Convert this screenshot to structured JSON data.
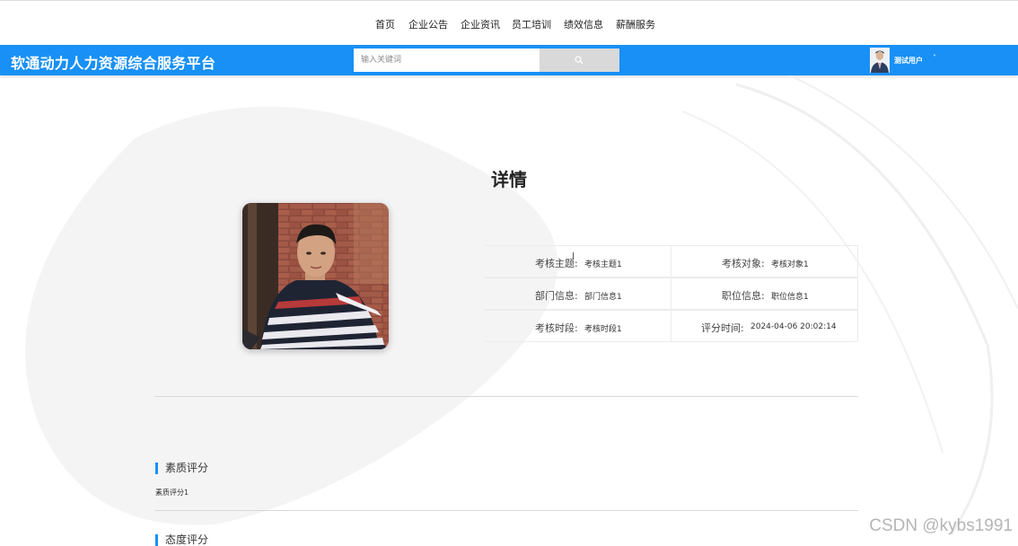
{
  "topnav": {
    "items": [
      {
        "label": "首页"
      },
      {
        "label": "企业公告"
      },
      {
        "label": "企业资讯"
      },
      {
        "label": "员工培训"
      },
      {
        "label": "绩效信息"
      },
      {
        "label": "薪酬服务"
      }
    ]
  },
  "header": {
    "brand": "软通动力人力资源综合服务平台",
    "search": {
      "placeholder": "输入关键词",
      "icon": "search-icon"
    },
    "user": {
      "name": "测试用户",
      "caret": "˅"
    },
    "color": "#1890f5"
  },
  "main": {
    "title": "详情",
    "details": [
      {
        "label": "考核主题:",
        "value": "考核主题1"
      },
      {
        "label": "考核对象:",
        "value": "考核对象1"
      },
      {
        "label": "部门信息:",
        "value": "部门信息1"
      },
      {
        "label": "职位信息:",
        "value": "职位信息1"
      },
      {
        "label": "考核时段:",
        "value": "考核时段1"
      },
      {
        "label": "评分时间:",
        "value": "2024-04-06 20:02:14"
      }
    ],
    "sections": [
      {
        "heading": "素质评分",
        "value": "素质评分1"
      },
      {
        "heading": "态度评分",
        "value": ""
      }
    ]
  },
  "watermark": "CSDN @kybs1991"
}
